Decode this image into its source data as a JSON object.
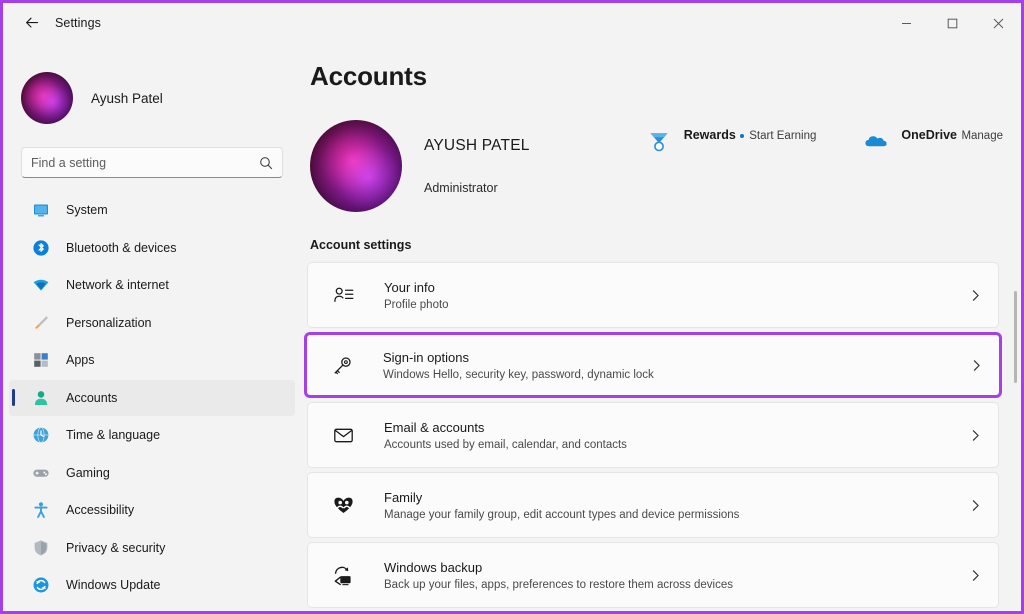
{
  "window": {
    "titlebar_title": "Settings",
    "back_icon": "back-arrow-icon",
    "minimize_label": "–",
    "maximize_label": "□",
    "close_label": "✕",
    "accent_highlight_color": "#A540E8",
    "selection_accent_color": "#1F3A93",
    "background_color": "#F3F3F3"
  },
  "sidebar": {
    "profile": {
      "name": "Ayush Patel",
      "avatar_icon": "user-avatar-photo"
    },
    "search": {
      "placeholder": "Find a setting",
      "value": "",
      "icon": "search-icon"
    },
    "items": [
      {
        "label": "System",
        "icon": "system-monitor-icon",
        "selected": false
      },
      {
        "label": "Bluetooth & devices",
        "icon": "bluetooth-icon",
        "selected": false
      },
      {
        "label": "Network & internet",
        "icon": "wifi-icon",
        "selected": false
      },
      {
        "label": "Personalization",
        "icon": "paintbrush-icon",
        "selected": false
      },
      {
        "label": "Apps",
        "icon": "apps-grid-icon",
        "selected": false
      },
      {
        "label": "Accounts",
        "icon": "person-icon",
        "selected": true
      },
      {
        "label": "Time & language",
        "icon": "clock-globe-icon",
        "selected": false
      },
      {
        "label": "Gaming",
        "icon": "gamepad-icon",
        "selected": false
      },
      {
        "label": "Accessibility",
        "icon": "accessibility-person-icon",
        "selected": false
      },
      {
        "label": "Privacy & security",
        "icon": "shield-icon",
        "selected": false
      },
      {
        "label": "Windows Update",
        "icon": "update-refresh-icon",
        "selected": false
      }
    ]
  },
  "main": {
    "page_title": "Accounts",
    "account": {
      "name": "AYUSH PATEL",
      "role": "Administrator",
      "avatar_icon": "user-avatar-photo-large"
    },
    "services": [
      {
        "title": "Rewards",
        "subtitle": "Start Earning",
        "icon": "rewards-medal-icon",
        "has_dot": true
      },
      {
        "title": "OneDrive",
        "subtitle": "Manage",
        "icon": "onedrive-cloud-icon",
        "has_dot": false
      }
    ],
    "section_label": "Account settings",
    "settings": [
      {
        "title": "Your info",
        "subtitle": "Profile photo",
        "icon": "person-info-icon",
        "chevron": "chevron-right-icon",
        "highlighted": false
      },
      {
        "title": "Sign-in options",
        "subtitle": "Windows Hello, security key, password, dynamic lock",
        "icon": "key-icon",
        "chevron": "chevron-right-icon",
        "highlighted": true
      },
      {
        "title": "Email & accounts",
        "subtitle": "Accounts used by email, calendar, and contacts",
        "icon": "envelope-icon",
        "chevron": "chevron-right-icon",
        "highlighted": false
      },
      {
        "title": "Family",
        "subtitle": "Manage your family group, edit account types and device permissions",
        "icon": "family-heart-icon",
        "chevron": "chevron-right-icon",
        "highlighted": false
      },
      {
        "title": "Windows backup",
        "subtitle": "Back up your files, apps, preferences to restore them across devices",
        "icon": "backup-sync-icon",
        "chevron": "chevron-right-icon",
        "highlighted": false
      }
    ]
  }
}
